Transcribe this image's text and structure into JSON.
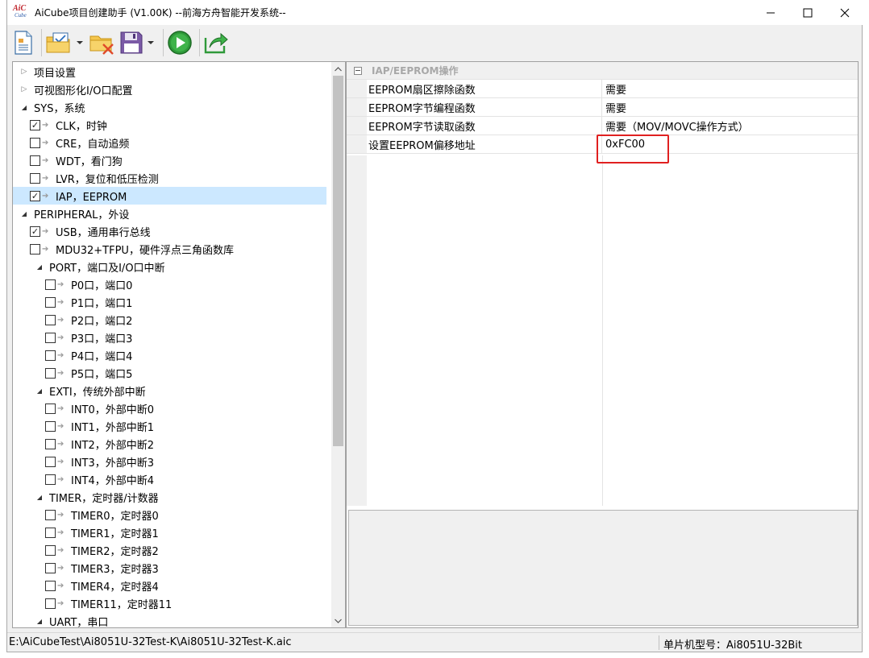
{
  "window": {
    "title": "AiCube项目创建助手 (V1.00K) --前海方舟智能开发系统--",
    "logo_top": "AiC",
    "logo_bottom": "Cube"
  },
  "toolbar": {
    "buttons": [
      "new-document",
      "open-project",
      "close-project",
      "save-project",
      "run",
      "export"
    ]
  },
  "tree": {
    "items": [
      {
        "label": "项目设置",
        "level": 0,
        "toggle": "collapsed",
        "checkbox": null
      },
      {
        "label": "可视图形化I/O口配置",
        "level": 0,
        "toggle": "collapsed",
        "checkbox": null
      },
      {
        "label": "SYS，系统",
        "level": 0,
        "toggle": "expanded",
        "checkbox": null
      },
      {
        "label": "CLK，时钟",
        "level": 1,
        "toggle": null,
        "checkbox": true
      },
      {
        "label": "CRE，自动追频",
        "level": 1,
        "toggle": null,
        "checkbox": false
      },
      {
        "label": "WDT，看门狗",
        "level": 1,
        "toggle": null,
        "checkbox": false
      },
      {
        "label": "LVR，复位和低压检测",
        "level": 1,
        "toggle": null,
        "checkbox": false
      },
      {
        "label": "IAP，EEPROM",
        "level": 1,
        "toggle": null,
        "checkbox": true,
        "selected": true
      },
      {
        "label": "PERIPHERAL，外设",
        "level": 0,
        "toggle": "expanded",
        "checkbox": null
      },
      {
        "label": "USB，通用串行总线",
        "level": 1,
        "toggle": null,
        "checkbox": true
      },
      {
        "label": "MDU32+TFPU，硬件浮点三角函数库",
        "level": 1,
        "toggle": null,
        "checkbox": false
      },
      {
        "label": "PORT，端口及I/O口中断",
        "level": 1,
        "toggle": "expanded",
        "checkbox": null,
        "group": true
      },
      {
        "label": "P0口，端口0",
        "level": 2,
        "toggle": null,
        "checkbox": false
      },
      {
        "label": "P1口，端口1",
        "level": 2,
        "toggle": null,
        "checkbox": false
      },
      {
        "label": "P2口，端口2",
        "level": 2,
        "toggle": null,
        "checkbox": false
      },
      {
        "label": "P3口，端口3",
        "level": 2,
        "toggle": null,
        "checkbox": false
      },
      {
        "label": "P4口，端口4",
        "level": 2,
        "toggle": null,
        "checkbox": false
      },
      {
        "label": "P5口，端口5",
        "level": 2,
        "toggle": null,
        "checkbox": false
      },
      {
        "label": "EXTI，传统外部中断",
        "level": 1,
        "toggle": "expanded",
        "checkbox": null,
        "group": true
      },
      {
        "label": "INT0，外部中断0",
        "level": 2,
        "toggle": null,
        "checkbox": false
      },
      {
        "label": "INT1，外部中断1",
        "level": 2,
        "toggle": null,
        "checkbox": false
      },
      {
        "label": "INT2，外部中断2",
        "level": 2,
        "toggle": null,
        "checkbox": false
      },
      {
        "label": "INT3，外部中断3",
        "level": 2,
        "toggle": null,
        "checkbox": false
      },
      {
        "label": "INT4，外部中断4",
        "level": 2,
        "toggle": null,
        "checkbox": false
      },
      {
        "label": "TIMER，定时器/计数器",
        "level": 1,
        "toggle": "expanded",
        "checkbox": null,
        "group": true
      },
      {
        "label": "TIMER0，定时器0",
        "level": 2,
        "toggle": null,
        "checkbox": false
      },
      {
        "label": "TIMER1，定时器1",
        "level": 2,
        "toggle": null,
        "checkbox": false
      },
      {
        "label": "TIMER2，定时器2",
        "level": 2,
        "toggle": null,
        "checkbox": false
      },
      {
        "label": "TIMER3，定时器3",
        "level": 2,
        "toggle": null,
        "checkbox": false
      },
      {
        "label": "TIMER4，定时器4",
        "level": 2,
        "toggle": null,
        "checkbox": false
      },
      {
        "label": "TIMER11，定时器11",
        "level": 2,
        "toggle": null,
        "checkbox": false
      },
      {
        "label": "UART，串口",
        "level": 1,
        "toggle": "expanded",
        "checkbox": null,
        "group": true
      }
    ]
  },
  "properties": {
    "category": "IAP/EEPROM操作",
    "rows": [
      {
        "name": "EEPROM扇区擦除函数",
        "value": "需要"
      },
      {
        "name": "EEPROM字节编程函数",
        "value": "需要"
      },
      {
        "name": "EEPROM字节读取函数",
        "value": "需要（MOV/MOVC操作方式）"
      },
      {
        "name": "设置EEPROM偏移地址",
        "value": "0xFC00"
      }
    ]
  },
  "status": {
    "path": "E:\\AiCubeTest\\Ai8051U-32Test-K\\Ai8051U-32Test-K.aic",
    "chip": "单片机型号：Ai8051U-32Bit"
  },
  "colors": {
    "selection": "#cce8ff",
    "highlight": "#e02020"
  }
}
